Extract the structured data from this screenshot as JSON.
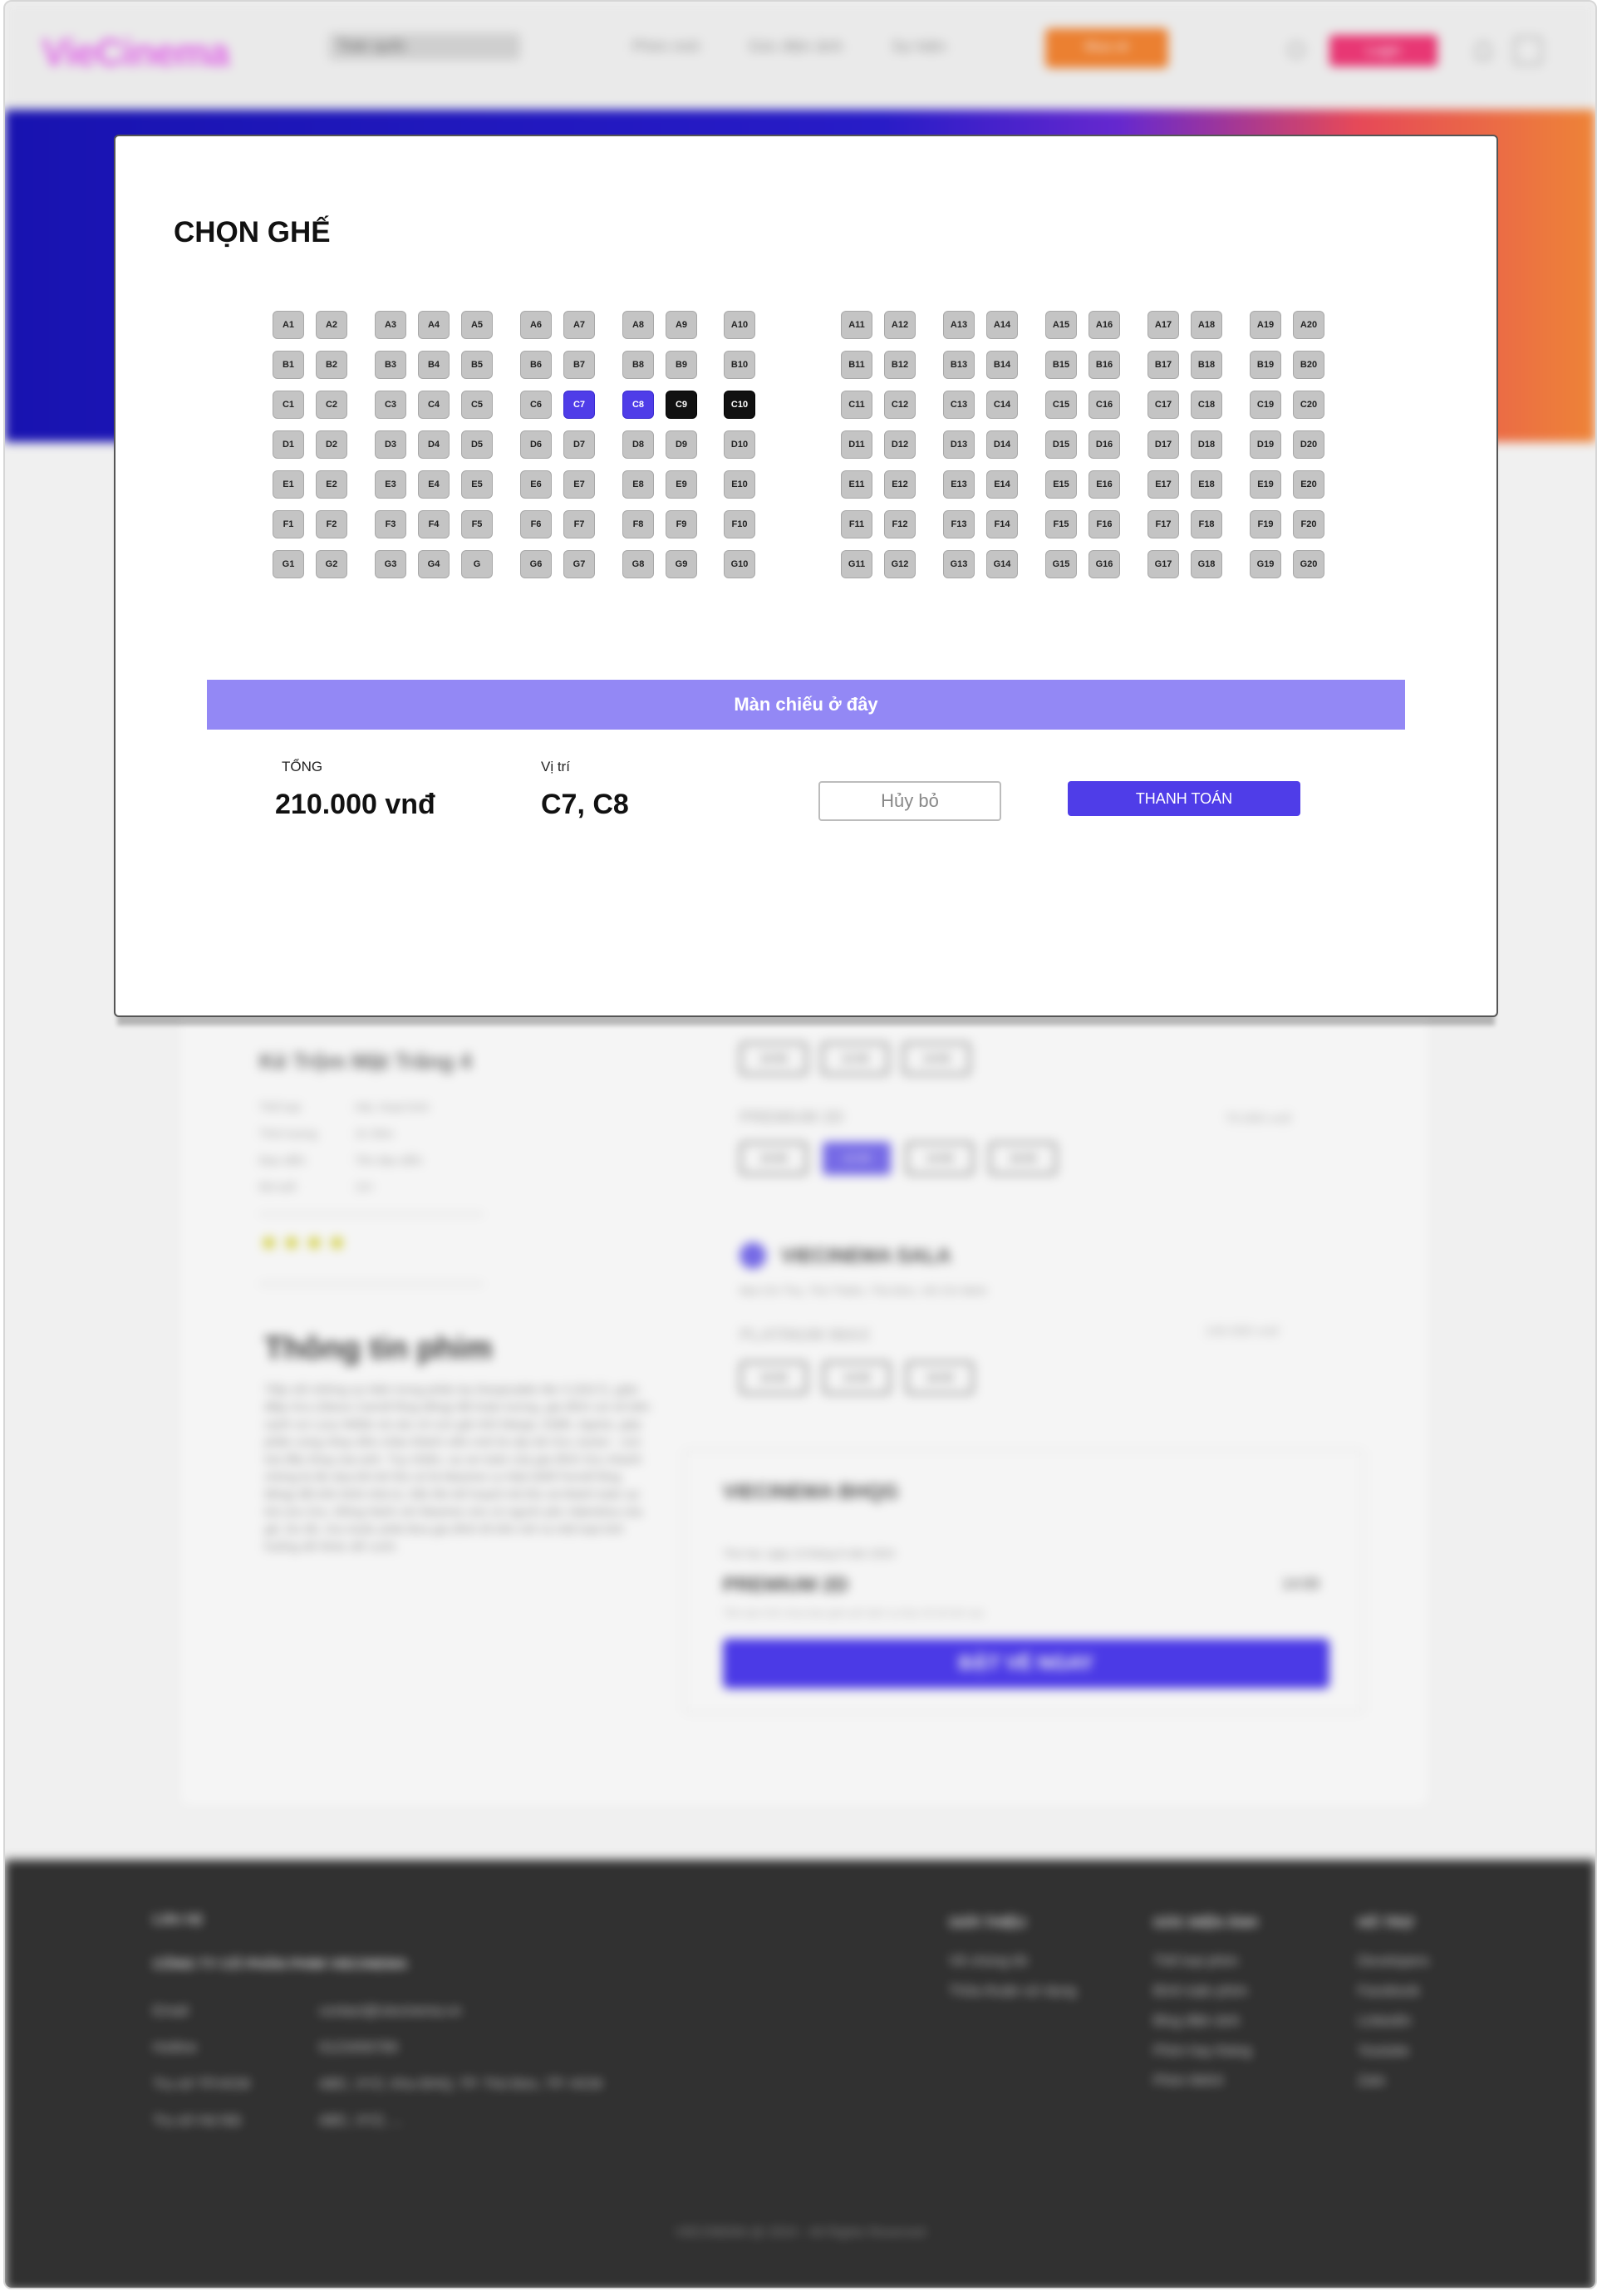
{
  "header": {
    "logo": "VieCinema",
    "region": "Toàn quốc",
    "nav": [
      "Phim mới",
      "Góc điện ảnh",
      "Sự kiện"
    ],
    "buy_ticket": "Mua vé",
    "login": "Login"
  },
  "movie": {
    "title": "Kẻ Trộm Mặt Trăng 4",
    "info": [
      {
        "label": "Thể loại",
        "value": "Hài, Hoạt hình"
      },
      {
        "label": "Thời lượng",
        "value": "1h 35m"
      },
      {
        "label": "Đạo diễn",
        "value": "Tên đạo diễn"
      },
      {
        "label": "Độ tuổi",
        "value": "13+"
      }
    ],
    "stars": "★★★★",
    "synopsis_title": "Thông tin phim",
    "synopsis": "Tiếp nối những sự kiện trong phần ba Despicable Me 3 (2017), gián điệp Gru (Steve Carrell lồng tiếng) đã hoàn lương, gia đình vui vẻ bên cạnh vợ Lucy Wilde và các cô con gái nhỏ Margo, Edith, Agnes, góp phần cùng nhau đón chào thành viên mới là cậu bé Gru Junior - con trai đầu lòng của anh. Tuy nhiên, sự an toàn của gia đình Gru nhanh chóng bị đe dọa khi kẻ thù cũ là Maxime Le Mal (Will Ferrell lồng tiếng) đã trốn khỏi nhà tù, hắn lên kế hoạch trả thù và thành toán sự trả cứu Gru. Đồng hành với Maxime còn có người yêu Valentina của gã. Do đó, Gru buộc phải đưa gia đình đi trốn mở ra một loạt tình huống dở khóc dở cười."
  },
  "showtimes": {
    "formats": [
      {
        "name": "PREMIUM 2D",
        "price": "70.000 vnđ"
      },
      {
        "name": "PLATINUM IMAX",
        "price": "140.000 vnđ"
      }
    ],
    "times": [
      "10:00",
      "12:30",
      "14:00",
      "16:00"
    ],
    "cinema_name": "VIECINEMA SALA",
    "cinema_address": "Mai Chí Thọ, Thủ Thiêm, Thủ Đức, Hồ Chí Minh"
  },
  "booking": {
    "cinema": "VIECINEMA BHQG",
    "date": "Thứ hai, ngày 13 tháng 8 năm 2024",
    "format": "PREMIUM 2D",
    "time": "14:00",
    "note": "Tiền tạm tính chưa bao gồm phí dịch vụ thực tế sẽ tính sau",
    "cta": "ĐẶT VÉ NGAY"
  },
  "footer": {
    "contact_heading": "Liên hệ",
    "company": "CÔNG TY CỔ PHẦN PHIM VIECINEMA",
    "contacts": [
      {
        "label": "Email",
        "value": "contact@viecinema.vn"
      },
      {
        "label": "Hotline",
        "value": "0123456789"
      },
      {
        "label": "Trụ sở TP.HCM",
        "value": "ABC, XYZ, Khu ĐHQ, TP. Thủ Đức, TP. HCM"
      },
      {
        "label": "Trụ sở Hà Nội",
        "value": "ABC, XYZ, ..."
      }
    ],
    "columns": [
      {
        "heading": "GIỚI THIỆU",
        "items": [
          "Về chúng tôi",
          "Thỏa thuận sử dụng"
        ]
      },
      {
        "heading": "GÓC ĐIỆN ẢNH",
        "items": [
          "Thể loại phim",
          "Bình luận phim",
          "Blog điện ảnh",
          "Phim hay tháng",
          "Phim IMAX"
        ]
      },
      {
        "heading": "HỖ TRỢ",
        "items": [
          "Developers",
          "Facebook",
          "LinkedIn",
          "Youtube",
          "Zalo"
        ]
      }
    ],
    "copyright": "VIECINEMA @ 2024 - All Rights Reserved"
  },
  "seat_modal": {
    "title": "CHỌN GHẾ",
    "screen_label": "Màn chiếu ở đây",
    "total_label": "TỔNG",
    "total_value": "210.000 vnđ",
    "position_label": "Vị trí",
    "position_value": "C7, C8",
    "cancel_label": "Hủy bỏ",
    "pay_label": "THANH TOÁN",
    "left_block": [
      [
        "A1",
        "A2",
        "A3",
        "A4",
        "A5",
        "A6",
        "A7",
        "A8",
        "A9",
        "A10"
      ],
      [
        "B1",
        "B2",
        "B3",
        "B4",
        "B5",
        "B6",
        "B7",
        "B8",
        "B9",
        "B10"
      ],
      [
        "C1",
        "C2",
        "C3",
        "C4",
        "C5",
        "C6",
        "C7",
        "C8",
        "C9",
        "C10"
      ],
      [
        "D1",
        "D2",
        "D3",
        "D4",
        "D5",
        "D6",
        "D7",
        "D8",
        "D9",
        "D10"
      ],
      [
        "E1",
        "E2",
        "E3",
        "E4",
        "E5",
        "E6",
        "E7",
        "E8",
        "E9",
        "E10"
      ],
      [
        "F1",
        "F2",
        "F3",
        "F4",
        "F5",
        "F6",
        "F7",
        "F8",
        "F9",
        "F10"
      ],
      [
        "G1",
        "G2",
        "G3",
        "G4",
        "G",
        "G6",
        "G7",
        "G8",
        "G9",
        "G10"
      ]
    ],
    "right_block": [
      [
        "A11",
        "A12",
        "A13",
        "A14",
        "A15",
        "A16",
        "A17",
        "A18",
        "A19",
        "A20"
      ],
      [
        "B11",
        "B12",
        "B13",
        "B14",
        "B15",
        "B16",
        "B17",
        "B18",
        "B19",
        "B20"
      ],
      [
        "C11",
        "C12",
        "C13",
        "C14",
        "C15",
        "C16",
        "C17",
        "C18",
        "C19",
        "C20"
      ],
      [
        "D11",
        "D12",
        "D13",
        "D14",
        "D15",
        "D16",
        "D17",
        "D18",
        "D19",
        "D20"
      ],
      [
        "E11",
        "E12",
        "E13",
        "E14",
        "E15",
        "E16",
        "E17",
        "E18",
        "E19",
        "E20"
      ],
      [
        "F11",
        "F12",
        "F13",
        "F14",
        "F15",
        "F16",
        "F17",
        "F18",
        "F19",
        "F20"
      ],
      [
        "G11",
        "G12",
        "G13",
        "G14",
        "G15",
        "G16",
        "G17",
        "G18",
        "G19",
        "G20"
      ]
    ],
    "selected_seats": [
      "C7",
      "C8"
    ],
    "booked_seats": [
      "C9",
      "C10"
    ],
    "colors": {
      "selected": "#4f3de8",
      "booked": "#111111",
      "available": "#c4c4c4",
      "screen": "#9388f5"
    }
  }
}
